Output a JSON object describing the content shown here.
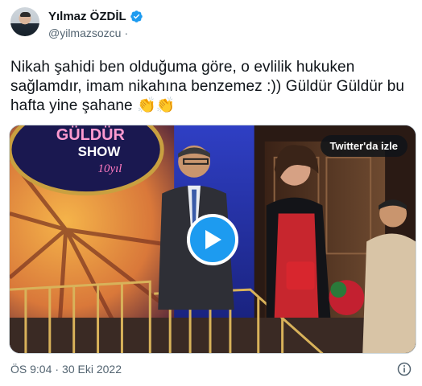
{
  "author": {
    "display_name": "Yılmaz ÖZDİL",
    "handle": "@yilmazsozcu",
    "separator": "·"
  },
  "tweet": {
    "text": "Nikah şahidi ben olduğuma göre, o evlilik hukuken sağlamdır, imam nikahına benzemez :)) Güldür Güldür bu hafta yine şahane",
    "emoji": "👏👏"
  },
  "media": {
    "watch_label": "Twitter'da izle",
    "sign_text_top": "GÜLDÜR",
    "sign_text_show": "SHOW",
    "sign_text_year": "10yıl"
  },
  "meta": {
    "time": "ÖS 9:04",
    "separator": "·",
    "date": "30 Eki 2022"
  },
  "colors": {
    "accent": "#1d9bf0",
    "text": "#0f1419",
    "muted": "#536471"
  },
  "icons": {
    "verified": "verified-badge-icon",
    "play": "play-icon",
    "info": "info-icon"
  }
}
